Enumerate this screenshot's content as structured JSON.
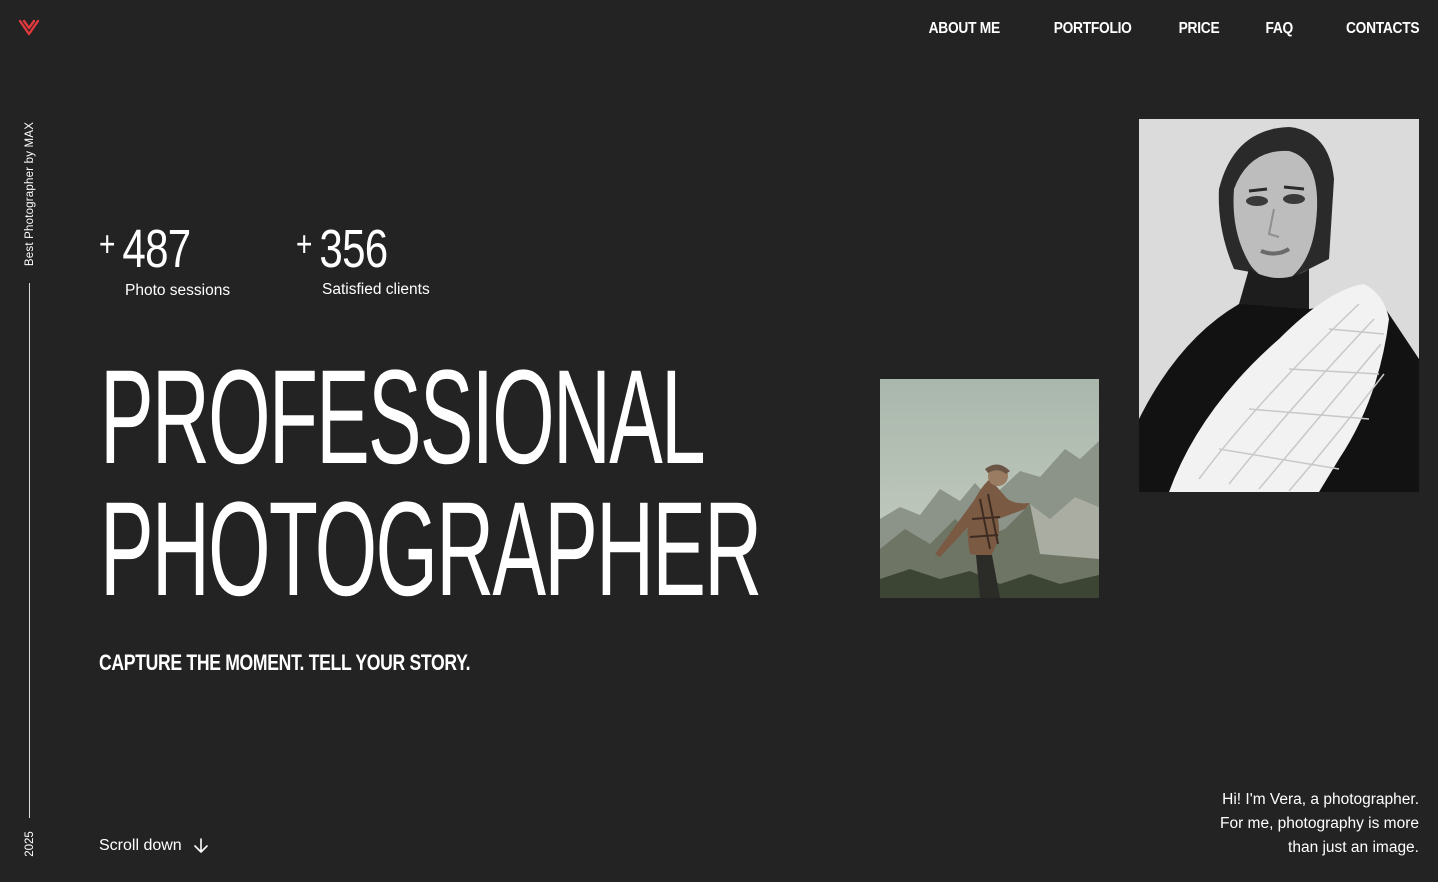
{
  "logo": {
    "icon": "heart-v-icon",
    "color": "#e0393e"
  },
  "nav": {
    "items": [
      {
        "label": "ABOUT ME"
      },
      {
        "label": "PORTFOLIO"
      },
      {
        "label": "PRICE"
      },
      {
        "label": "FAQ"
      },
      {
        "label": "CONTACTS"
      }
    ]
  },
  "side": {
    "caption": "Best Photographer by MAX",
    "year": "2025"
  },
  "stats": [
    {
      "prefix": "+",
      "value": "487",
      "label": "Photo sessions"
    },
    {
      "prefix": "+",
      "value": "356",
      "label": "Satisfied clients"
    }
  ],
  "hero": {
    "line1": "PROFESSIONAL",
    "line2": "PHOTOGRAPHER",
    "tagline": "CAPTURE THE MOMENT. TELL YOUR STORY."
  },
  "scroll": {
    "label": "Scroll down",
    "icon": "arrow-down-icon"
  },
  "intro": {
    "line1": "Hi! I'm Vera, a photographer.",
    "line2": "For me, photography is more",
    "line3": "than just an image."
  },
  "colors": {
    "background": "#232323",
    "text": "#ffffff",
    "accent": "#e0393e"
  }
}
